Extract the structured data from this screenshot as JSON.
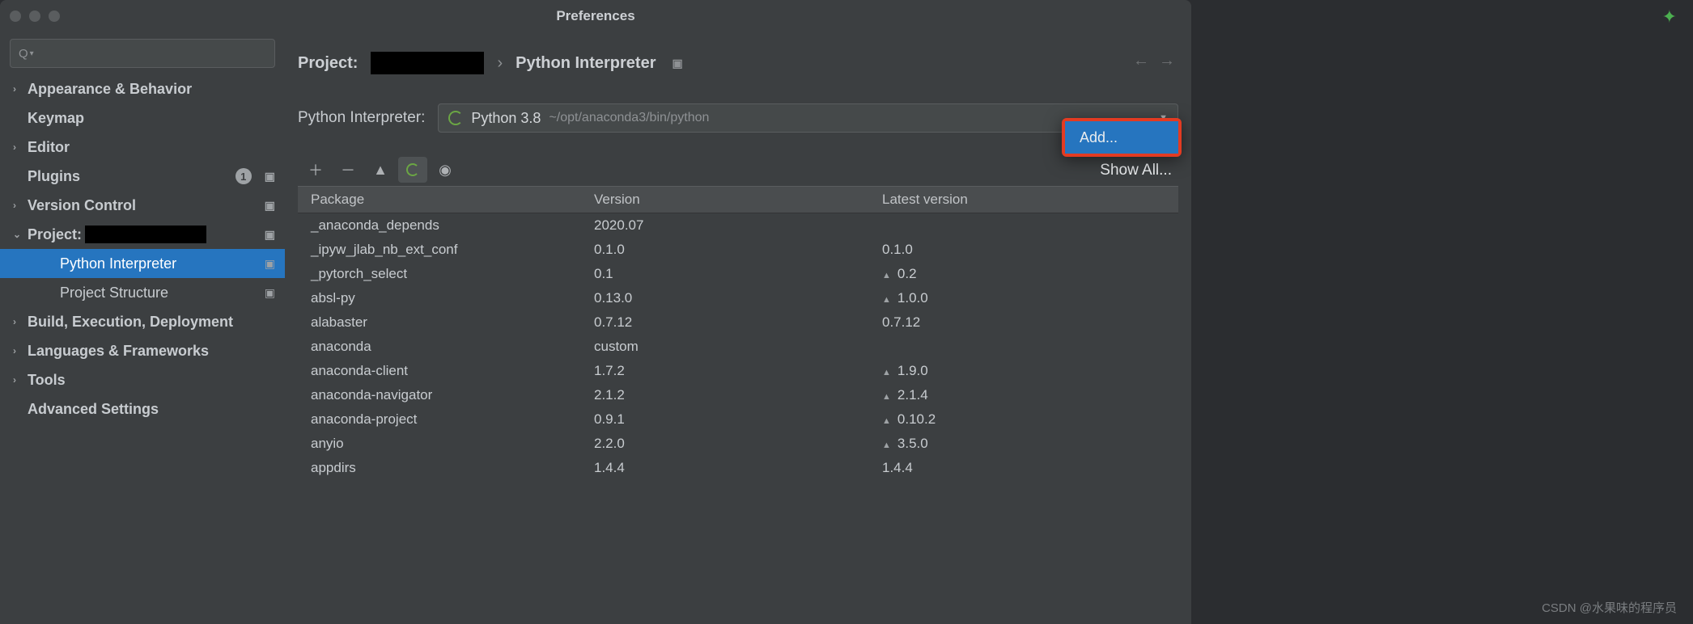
{
  "window_title": "Preferences",
  "sidebar": {
    "items": [
      {
        "label": "Appearance & Behavior",
        "arrow": "›",
        "mod": false
      },
      {
        "label": "Keymap",
        "arrow": "",
        "mod": false
      },
      {
        "label": "Editor",
        "arrow": "›",
        "mod": false
      },
      {
        "label": "Plugins",
        "arrow": "",
        "mod": true,
        "badge": "1"
      },
      {
        "label": "Version Control",
        "arrow": "›",
        "mod": true
      },
      {
        "label": "Project:",
        "arrow": "⌄",
        "mod": true,
        "redact": true
      },
      {
        "label": "Python Interpreter",
        "arrow": "",
        "mod": true,
        "child": true,
        "selected": true
      },
      {
        "label": "Project Structure",
        "arrow": "",
        "mod": true,
        "child": true
      },
      {
        "label": "Build, Execution, Deployment",
        "arrow": "›",
        "mod": false
      },
      {
        "label": "Languages & Frameworks",
        "arrow": "›",
        "mod": false
      },
      {
        "label": "Tools",
        "arrow": "›",
        "mod": false
      },
      {
        "label": "Advanced Settings",
        "arrow": "",
        "mod": false
      }
    ]
  },
  "breadcrumb": {
    "project_label": "Project:",
    "sep": "›",
    "page": "Python Interpreter"
  },
  "interpreter": {
    "label": "Python Interpreter:",
    "name": "Python 3.8",
    "path": "~/opt/anaconda3/bin/python"
  },
  "dropdown": {
    "add": "Add...",
    "show_all": "Show All..."
  },
  "table": {
    "headers": {
      "package": "Package",
      "version": "Version",
      "latest": "Latest version"
    },
    "rows": [
      {
        "pkg": "_anaconda_depends",
        "ver": "2020.07",
        "lat": "",
        "up": false
      },
      {
        "pkg": "_ipyw_jlab_nb_ext_conf",
        "ver": "0.1.0",
        "lat": "0.1.0",
        "up": false
      },
      {
        "pkg": "_pytorch_select",
        "ver": "0.1",
        "lat": "0.2",
        "up": true
      },
      {
        "pkg": "absl-py",
        "ver": "0.13.0",
        "lat": "1.0.0",
        "up": true
      },
      {
        "pkg": "alabaster",
        "ver": "0.7.12",
        "lat": "0.7.12",
        "up": false
      },
      {
        "pkg": "anaconda",
        "ver": "custom",
        "lat": "",
        "up": false
      },
      {
        "pkg": "anaconda-client",
        "ver": "1.7.2",
        "lat": "1.9.0",
        "up": true
      },
      {
        "pkg": "anaconda-navigator",
        "ver": "2.1.2",
        "lat": "2.1.4",
        "up": true
      },
      {
        "pkg": "anaconda-project",
        "ver": "0.9.1",
        "lat": "0.10.2",
        "up": true
      },
      {
        "pkg": "anyio",
        "ver": "2.2.0",
        "lat": "3.5.0",
        "up": true
      },
      {
        "pkg": "appdirs",
        "ver": "1.4.4",
        "lat": "1.4.4",
        "up": false
      }
    ]
  },
  "watermark": "CSDN @水果味的程序员"
}
